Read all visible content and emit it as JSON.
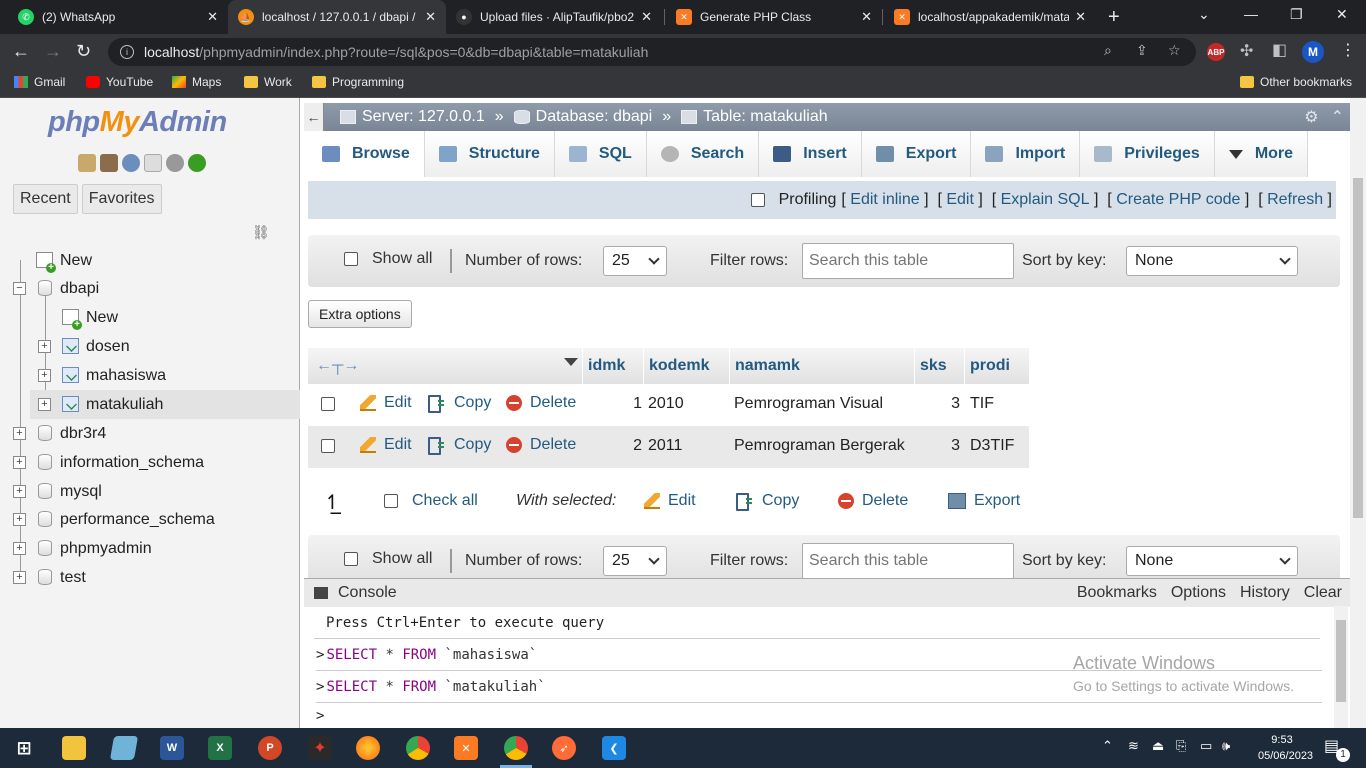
{
  "browser": {
    "tabs": [
      {
        "title": "(2) WhatsApp",
        "icon": "whatsapp-icon",
        "color": "#25d366"
      },
      {
        "title": "localhost / 127.0.0.1 / dbapi /",
        "icon": "phpmyadmin-icon",
        "color": "#f29111"
      },
      {
        "title": "Upload files · AlipTaufik/pbo2",
        "icon": "github-icon",
        "color": "#333333"
      },
      {
        "title": "Generate PHP Class",
        "icon": "xampp-icon",
        "color": "#fb7a24"
      },
      {
        "title": "localhost/appakademik/mata",
        "icon": "xampp-icon",
        "color": "#fb7a24"
      }
    ],
    "url_host": "localhost",
    "url_path": "/phpmyadmin/index.php?route=/sql&pos=0&db=dbapi&table=matakuliah",
    "profile_initial": "M",
    "bookmarks": [
      {
        "label": "Gmail",
        "icon": "gmail-icon"
      },
      {
        "label": "YouTube",
        "icon": "youtube-icon"
      },
      {
        "label": "Maps",
        "icon": "maps-icon"
      },
      {
        "label": "Work",
        "icon": "folder-icon"
      },
      {
        "label": "Programming",
        "icon": "folder-icon"
      }
    ],
    "other_bookmarks": "Other bookmarks"
  },
  "nav": {
    "recent": "Recent",
    "favorites": "Favorites",
    "tree": [
      {
        "label": "New",
        "kind": "new",
        "level": 0
      },
      {
        "label": "dbapi",
        "kind": "db",
        "level": 0,
        "expanded": true
      },
      {
        "label": "New",
        "kind": "new",
        "level": 1
      },
      {
        "label": "dosen",
        "kind": "table",
        "level": 1
      },
      {
        "label": "mahasiswa",
        "kind": "table",
        "level": 1
      },
      {
        "label": "matakuliah",
        "kind": "table",
        "level": 1,
        "selected": true
      },
      {
        "label": "dbr3r4",
        "kind": "db",
        "level": 0
      },
      {
        "label": "information_schema",
        "kind": "db",
        "level": 0
      },
      {
        "label": "mysql",
        "kind": "db",
        "level": 0
      },
      {
        "label": "performance_schema",
        "kind": "db",
        "level": 0
      },
      {
        "label": "phpmyadmin",
        "kind": "db",
        "level": 0
      },
      {
        "label": "test",
        "kind": "db",
        "level": 0
      }
    ]
  },
  "breadcrumb": {
    "server": "Server: 127.0.0.1",
    "database": "Database: dbapi",
    "table": "Table: matakuliah",
    "separator": "»"
  },
  "menu_tabs": [
    {
      "label": "Browse",
      "icon": "browse-icon"
    },
    {
      "label": "Structure",
      "icon": "structure-icon"
    },
    {
      "label": "SQL",
      "icon": "sql-icon"
    },
    {
      "label": "Search",
      "icon": "search-icon"
    },
    {
      "label": "Insert",
      "icon": "insert-icon"
    },
    {
      "label": "Export",
      "icon": "export-icon"
    },
    {
      "label": "Import",
      "icon": "import-icon"
    },
    {
      "label": "Privileges",
      "icon": "privileges-icon"
    },
    {
      "label": "More",
      "icon": "caret-down-icon"
    }
  ],
  "profiling": {
    "label": "Profiling",
    "links": [
      "Edit inline",
      "Edit",
      "Explain SQL",
      "Create PHP code",
      "Refresh"
    ]
  },
  "nav_controls": {
    "show_all": "Show all",
    "number_of_rows_label": "Number of rows:",
    "number_of_rows_value": "25",
    "filter_rows_label": "Filter rows:",
    "filter_placeholder": "Search this table",
    "sort_by_key_label": "Sort by key:",
    "sort_by_key_value": "None"
  },
  "extra_options": "Extra options",
  "results": {
    "columns": [
      "idmk",
      "kodemk",
      "namamk",
      "sks",
      "prodi"
    ],
    "rows": [
      {
        "idmk": "1",
        "kodemk": "2010",
        "namamk": "Pemrograman Visual",
        "sks": "3",
        "prodi": "TIF"
      },
      {
        "idmk": "2",
        "kodemk": "2011",
        "namamk": "Pemrograman Bergerak",
        "sks": "3",
        "prodi": "D3TIF"
      }
    ],
    "row_actions": {
      "edit": "Edit",
      "copy": "Copy",
      "delete": "Delete"
    }
  },
  "with_selected": {
    "check_all": "Check all",
    "label": "With selected:",
    "edit": "Edit",
    "copy": "Copy",
    "delete": "Delete",
    "export": "Export"
  },
  "console": {
    "title": "Console",
    "links": [
      "Bookmarks",
      "Options",
      "History",
      "Clear"
    ],
    "hint": "Press Ctrl+Enter to execute query",
    "queries": [
      {
        "select": "SELECT",
        "star": "*",
        "from": "FROM",
        "table": "`mahasiswa`"
      },
      {
        "select": "SELECT",
        "star": "*",
        "from": "FROM",
        "table": "`matakuliah`"
      }
    ],
    "prompt": ">"
  },
  "watermark": {
    "line1": "Activate Windows",
    "line2": "Go to Settings to activate Windows."
  },
  "taskbar": {
    "time": "9:53",
    "date": "05/06/2023",
    "notification_count": "1"
  }
}
